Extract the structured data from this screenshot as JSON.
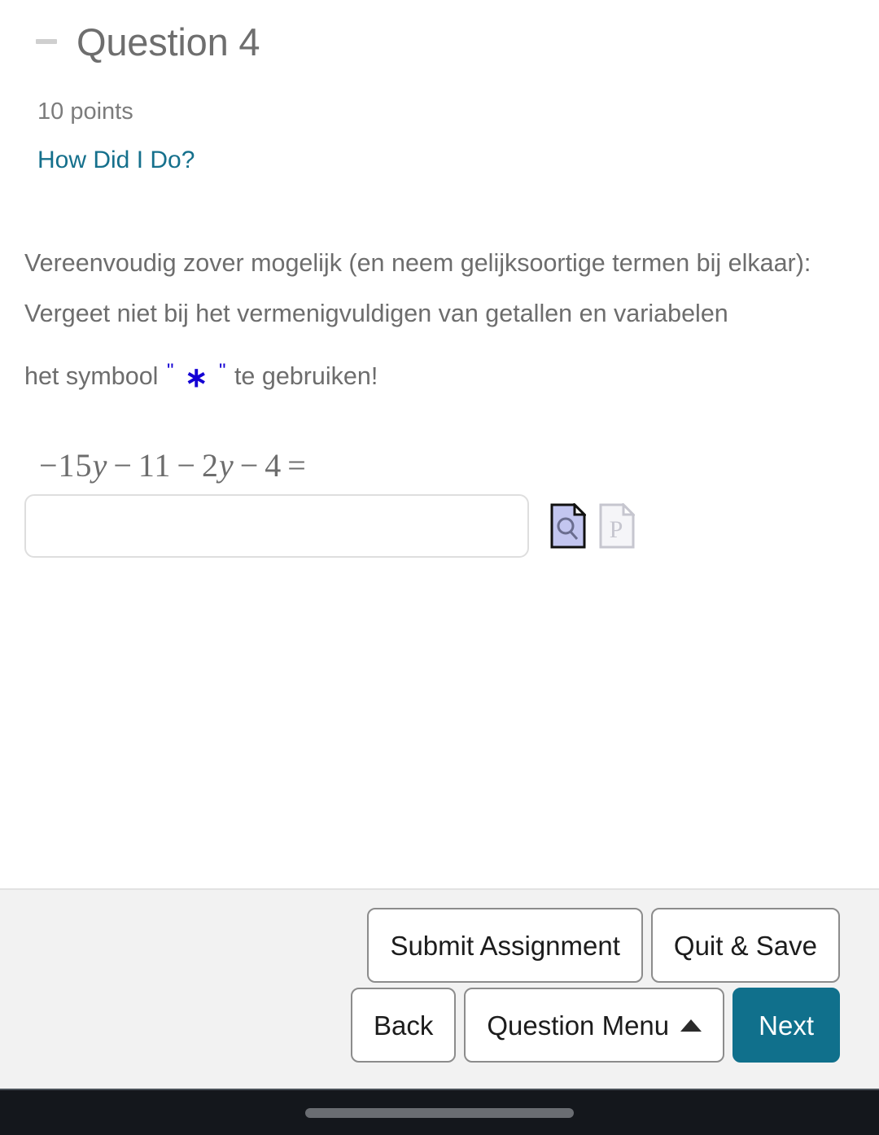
{
  "header": {
    "collapse_icon": "minus-icon",
    "title": "Question 4"
  },
  "meta": {
    "points": "10 points",
    "how_did_i_do": "How Did I Do?"
  },
  "question": {
    "line1": "Vereenvoudig zover mogelijk (en neem gelijksoortige termen bij elkaar):",
    "line2": "Vergeet niet bij het vermenigvuldigen van getallen en variabelen",
    "line3_before": "het symbool",
    "quote_open": "\"",
    "symbol": "∗",
    "quote_close": "\"",
    "line3_after": "te gebruiken!",
    "symbol_color": "#1400d4"
  },
  "math": {
    "expression": "−15y − 11 − 2y − 4 =",
    "tokens": [
      {
        "t": "−15",
        "k": "num"
      },
      {
        "t": "y",
        "k": "var"
      },
      {
        "t": "−",
        "k": "op"
      },
      {
        "t": "11",
        "k": "num"
      },
      {
        "t": "−",
        "k": "op"
      },
      {
        "t": "2",
        "k": "num"
      },
      {
        "t": "y",
        "k": "var"
      },
      {
        "t": "−",
        "k": "op"
      },
      {
        "t": "4",
        "k": "num"
      },
      {
        "t": "=",
        "k": "op"
      }
    ]
  },
  "answer": {
    "value": "",
    "placeholder": ""
  },
  "tools": [
    {
      "name": "preview-answer-icon",
      "enabled": true,
      "glyph": "page-magnifier"
    },
    {
      "name": "palette-icon",
      "enabled": false,
      "glyph": "page-p"
    }
  ],
  "footer": {
    "submit_assignment": "Submit Assignment",
    "quit_and_save": "Quit & Save",
    "back": "Back",
    "question_menu": "Question Menu",
    "question_menu_caret": "▲",
    "next": "Next",
    "next_color": "#10708c",
    "bar_background": "#f2f2f2"
  },
  "system_nav": {
    "background": "#14171c",
    "handle": "gesture-pill"
  }
}
